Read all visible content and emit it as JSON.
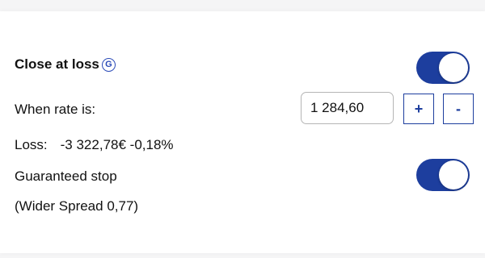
{
  "close_at_loss": {
    "label": "Close at loss",
    "badge": "G",
    "toggle_on": true
  },
  "rate": {
    "label": "When rate is:",
    "value": "1 284,60",
    "plus_label": "+",
    "minus_label": "-"
  },
  "loss": {
    "label": "Loss:",
    "value": "-3 322,78€ -0,18%"
  },
  "guaranteed_stop": {
    "label": "Guaranteed stop",
    "toggle_on": true,
    "spread_note": "(Wider Spread 0,77)"
  },
  "colors": {
    "accent": "#1d3e9e",
    "badge": "#2b4bb8"
  }
}
